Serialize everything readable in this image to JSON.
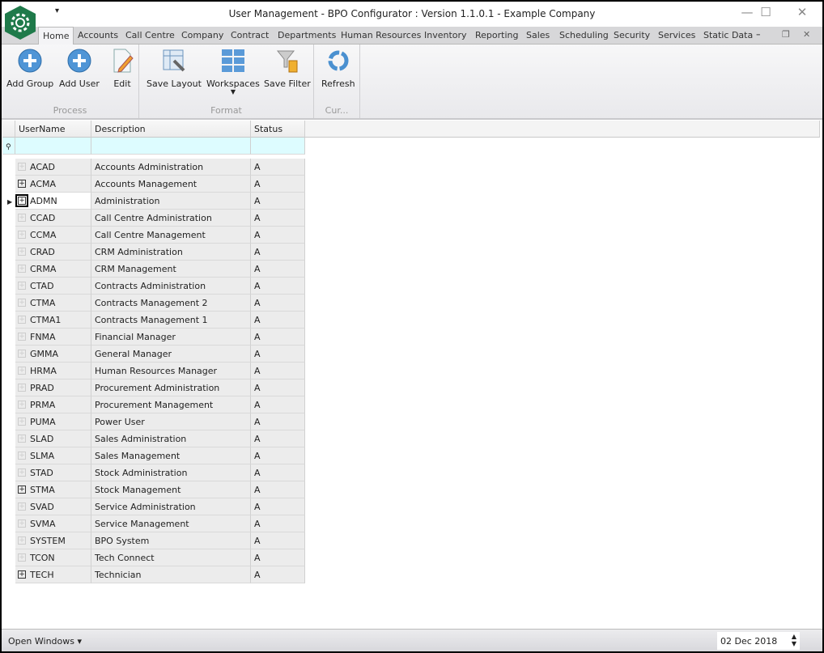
{
  "window": {
    "title": "User Management - BPO Configurator : Version 1.1.0.1 - Example Company"
  },
  "tabs": [
    "Home",
    "Accounts",
    "Call Centre",
    "Company",
    "Contract",
    "Departments",
    "Human Resources",
    "Inventory",
    "Reporting",
    "Sales",
    "Scheduling",
    "Security",
    "Services",
    "Static Data"
  ],
  "ribbon": {
    "groups": [
      {
        "label": "Process",
        "buttons": [
          "Add Group",
          "Add User",
          "Edit"
        ]
      },
      {
        "label": "Format",
        "buttons": [
          "Save Layout",
          "Workspaces",
          "Save Filter"
        ]
      },
      {
        "label": "Cur...",
        "buttons": [
          "Refresh"
        ]
      }
    ]
  },
  "grid": {
    "columns": [
      "UserName",
      "Description",
      "Status"
    ],
    "rows": [
      {
        "user": "ACAD",
        "desc": "Accounts Administration",
        "status": "A",
        "has_children": false
      },
      {
        "user": "ACMA",
        "desc": "Accounts Management",
        "status": "A",
        "has_children": true
      },
      {
        "user": "ADMN",
        "desc": "Administration",
        "status": "A",
        "has_children": true,
        "selected": true
      },
      {
        "user": "CCAD",
        "desc": "Call Centre Administration",
        "status": "A",
        "has_children": false
      },
      {
        "user": "CCMA",
        "desc": "Call Centre Management",
        "status": "A",
        "has_children": false
      },
      {
        "user": "CRAD",
        "desc": "CRM Administration",
        "status": "A",
        "has_children": false
      },
      {
        "user": "CRMA",
        "desc": "CRM Management",
        "status": "A",
        "has_children": false
      },
      {
        "user": "CTAD",
        "desc": "Contracts Administration",
        "status": "A",
        "has_children": false
      },
      {
        "user": "CTMA",
        "desc": "Contracts Management 2",
        "status": "A",
        "has_children": false
      },
      {
        "user": "CTMA1",
        "desc": "Contracts Management 1",
        "status": "A",
        "has_children": false
      },
      {
        "user": "FNMA",
        "desc": "Financial Manager",
        "status": "A",
        "has_children": false
      },
      {
        "user": "GMMA",
        "desc": "General Manager",
        "status": "A",
        "has_children": false
      },
      {
        "user": "HRMA",
        "desc": "Human Resources Manager",
        "status": "A",
        "has_children": false
      },
      {
        "user": "PRAD",
        "desc": "Procurement Administration",
        "status": "A",
        "has_children": false
      },
      {
        "user": "PRMA",
        "desc": "Procurement Management",
        "status": "A",
        "has_children": false
      },
      {
        "user": "PUMA",
        "desc": "Power User",
        "status": "A",
        "has_children": false
      },
      {
        "user": "SLAD",
        "desc": "Sales Administration",
        "status": "A",
        "has_children": false
      },
      {
        "user": "SLMA",
        "desc": "Sales Management",
        "status": "A",
        "has_children": false
      },
      {
        "user": "STAD",
        "desc": "Stock Administration",
        "status": "A",
        "has_children": false
      },
      {
        "user": "STMA",
        "desc": "Stock Management",
        "status": "A",
        "has_children": true
      },
      {
        "user": "SVAD",
        "desc": "Service Administration",
        "status": "A",
        "has_children": false
      },
      {
        "user": "SVMA",
        "desc": "Service Management",
        "status": "A",
        "has_children": false
      },
      {
        "user": "SYSTEM",
        "desc": "BPO System",
        "status": "A",
        "has_children": false
      },
      {
        "user": "TCON",
        "desc": "Tech Connect",
        "status": "A",
        "has_children": false
      },
      {
        "user": "TECH",
        "desc": "Technician",
        "status": "A",
        "has_children": true
      }
    ]
  },
  "statusbar": {
    "open_windows": "Open Windows",
    "date": "02 Dec 2018"
  }
}
